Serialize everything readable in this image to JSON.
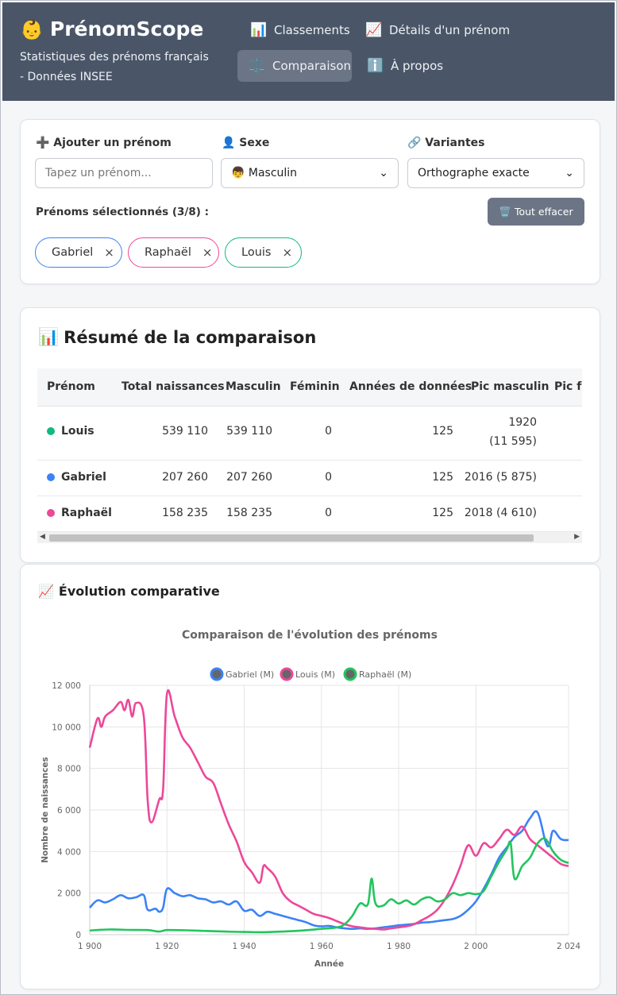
{
  "header": {
    "logo_icon": "baby-face-emoji",
    "logo_glyph": "👶",
    "title": "PrénomScope",
    "subtitle": "Statistiques des prénoms français - Données INSEE",
    "nav": [
      {
        "label": "Classements",
        "icon": "📊",
        "active": false
      },
      {
        "label": "Détails d'un prénom",
        "icon": "📈",
        "active": false
      },
      {
        "label": "Comparaison",
        "icon": "⚖️",
        "active": true
      },
      {
        "label": "À propos",
        "icon": "ℹ️",
        "active": false
      }
    ]
  },
  "controls": {
    "add_label": "➕ Ajouter un prénom",
    "add_placeholder": "Tapez un prénom...",
    "sex_label": "👤 Sexe",
    "sex_value": "👦 Masculin",
    "variants_label": "🔗 Variantes",
    "variants_value": "Orthographe exacte",
    "selected_label": "Prénoms sélectionnés (3/8) :",
    "clear_icon": "🗑️",
    "clear_label": "Tout effacer",
    "chips": [
      {
        "name": "Gabriel",
        "color": "#3b82f6"
      },
      {
        "name": "Raphaël",
        "color": "#ec4899"
      },
      {
        "name": "Louis",
        "color": "#10b981"
      }
    ]
  },
  "summary": {
    "icon": "📊",
    "title": "Résumé de la comparaison",
    "columns": [
      "Prénom",
      "Total naissances",
      "Masculin",
      "Féminin",
      "Années de données",
      "Pic masculin",
      "Pic fé"
    ],
    "rows": [
      {
        "name": "Louis",
        "color": "#10b981",
        "total": "539 110",
        "masc": "539 110",
        "fem": "0",
        "years": "125",
        "peak_year": "1920",
        "peak_val": "(11 595)"
      },
      {
        "name": "Gabriel",
        "color": "#3b82f6",
        "total": "207 260",
        "masc": "207 260",
        "fem": "0",
        "years": "125",
        "peak": "2016 (5 875)"
      },
      {
        "name": "Raphaël",
        "color": "#ec4899",
        "total": "158 235",
        "masc": "158 235",
        "fem": "0",
        "years": "125",
        "peak": "2018 (4 610)"
      }
    ]
  },
  "evolution": {
    "icon": "📈",
    "title": "Évolution comparative"
  },
  "chart_data": {
    "type": "line",
    "title": "Comparaison de l'évolution des prénoms",
    "xlabel": "Année",
    "ylabel": "Nombre de naissances",
    "xlim": [
      1900,
      2024
    ],
    "ylim": [
      0,
      12000
    ],
    "x_ticks": [
      "1 900",
      "1 920",
      "1 940",
      "1 960",
      "1 980",
      "2 000",
      "2 024"
    ],
    "x_tick_values": [
      1900,
      1920,
      1940,
      1960,
      1980,
      2000,
      2024
    ],
    "y_ticks": [
      "0",
      "2 000",
      "4 000",
      "6 000",
      "8 000",
      "10 000",
      "12 000"
    ],
    "y_tick_values": [
      0,
      2000,
      4000,
      6000,
      8000,
      10000,
      12000
    ],
    "grid": true,
    "legend_position": "top",
    "series": [
      {
        "name": "Gabriel (M)",
        "color": "#3b82f6",
        "points": [
          [
            1900,
            1300
          ],
          [
            1902,
            1650
          ],
          [
            1904,
            1550
          ],
          [
            1906,
            1700
          ],
          [
            1908,
            1900
          ],
          [
            1910,
            1750
          ],
          [
            1912,
            1800
          ],
          [
            1914,
            1900
          ],
          [
            1915,
            1200
          ],
          [
            1917,
            1250
          ],
          [
            1918,
            1100
          ],
          [
            1919,
            1300
          ],
          [
            1920,
            2200
          ],
          [
            1922,
            2000
          ],
          [
            1924,
            1850
          ],
          [
            1926,
            1900
          ],
          [
            1928,
            1750
          ],
          [
            1930,
            1700
          ],
          [
            1932,
            1550
          ],
          [
            1934,
            1600
          ],
          [
            1936,
            1450
          ],
          [
            1938,
            1600
          ],
          [
            1940,
            1150
          ],
          [
            1942,
            1200
          ],
          [
            1944,
            900
          ],
          [
            1946,
            1100
          ],
          [
            1948,
            1000
          ],
          [
            1950,
            900
          ],
          [
            1952,
            800
          ],
          [
            1954,
            700
          ],
          [
            1956,
            600
          ],
          [
            1958,
            450
          ],
          [
            1960,
            400
          ],
          [
            1962,
            420
          ],
          [
            1964,
            350
          ],
          [
            1966,
            300
          ],
          [
            1968,
            280
          ],
          [
            1970,
            300
          ],
          [
            1972,
            280
          ],
          [
            1974,
            300
          ],
          [
            1976,
            350
          ],
          [
            1978,
            400
          ],
          [
            1980,
            450
          ],
          [
            1982,
            480
          ],
          [
            1984,
            520
          ],
          [
            1986,
            580
          ],
          [
            1988,
            600
          ],
          [
            1990,
            650
          ],
          [
            1992,
            700
          ],
          [
            1994,
            750
          ],
          [
            1996,
            900
          ],
          [
            1998,
            1200
          ],
          [
            2000,
            1600
          ],
          [
            2002,
            2200
          ],
          [
            2004,
            2900
          ],
          [
            2006,
            3700
          ],
          [
            2008,
            4200
          ],
          [
            2010,
            4700
          ],
          [
            2012,
            5000
          ],
          [
            2014,
            5600
          ],
          [
            2016,
            5875
          ],
          [
            2018,
            4500
          ],
          [
            2019,
            4300
          ],
          [
            2020,
            5000
          ],
          [
            2022,
            4600
          ],
          [
            2024,
            4550
          ]
        ]
      },
      {
        "name": "Louis (M)",
        "color": "#ec4899",
        "points": [
          [
            1900,
            9000
          ],
          [
            1902,
            10400
          ],
          [
            1903,
            10000
          ],
          [
            1904,
            10500
          ],
          [
            1906,
            10800
          ],
          [
            1908,
            11200
          ],
          [
            1909,
            10800
          ],
          [
            1910,
            11300
          ],
          [
            1911,
            10500
          ],
          [
            1912,
            11150
          ],
          [
            1914,
            10500
          ],
          [
            1915,
            6500
          ],
          [
            1916,
            5400
          ],
          [
            1918,
            6500
          ],
          [
            1919,
            7000
          ],
          [
            1920,
            11595
          ],
          [
            1922,
            10500
          ],
          [
            1924,
            9500
          ],
          [
            1926,
            9000
          ],
          [
            1928,
            8300
          ],
          [
            1930,
            7600
          ],
          [
            1932,
            7300
          ],
          [
            1934,
            6300
          ],
          [
            1936,
            5300
          ],
          [
            1938,
            4500
          ],
          [
            1940,
            3500
          ],
          [
            1942,
            3000
          ],
          [
            1944,
            2500
          ],
          [
            1945,
            3300
          ],
          [
            1946,
            3200
          ],
          [
            1948,
            2800
          ],
          [
            1950,
            2000
          ],
          [
            1952,
            1600
          ],
          [
            1954,
            1400
          ],
          [
            1956,
            1200
          ],
          [
            1958,
            1000
          ],
          [
            1960,
            900
          ],
          [
            1962,
            800
          ],
          [
            1964,
            650
          ],
          [
            1966,
            500
          ],
          [
            1968,
            400
          ],
          [
            1970,
            350
          ],
          [
            1972,
            300
          ],
          [
            1974,
            280
          ],
          [
            1976,
            250
          ],
          [
            1978,
            300
          ],
          [
            1980,
            350
          ],
          [
            1982,
            400
          ],
          [
            1984,
            500
          ],
          [
            1986,
            700
          ],
          [
            1988,
            900
          ],
          [
            1990,
            1200
          ],
          [
            1992,
            1700
          ],
          [
            1994,
            2400
          ],
          [
            1996,
            3300
          ],
          [
            1998,
            4300
          ],
          [
            2000,
            3800
          ],
          [
            2002,
            4400
          ],
          [
            2004,
            4200
          ],
          [
            2006,
            4600
          ],
          [
            2008,
            5050
          ],
          [
            2010,
            4800
          ],
          [
            2012,
            5200
          ],
          [
            2014,
            4600
          ],
          [
            2016,
            4300
          ],
          [
            2018,
            4000
          ],
          [
            2020,
            3700
          ],
          [
            2022,
            3400
          ],
          [
            2024,
            3300
          ]
        ]
      },
      {
        "name": "Raphaël (M)",
        "color": "#22c55e",
        "points": [
          [
            1900,
            200
          ],
          [
            1905,
            250
          ],
          [
            1910,
            230
          ],
          [
            1915,
            220
          ],
          [
            1918,
            150
          ],
          [
            1920,
            220
          ],
          [
            1925,
            210
          ],
          [
            1930,
            180
          ],
          [
            1935,
            150
          ],
          [
            1940,
            130
          ],
          [
            1945,
            120
          ],
          [
            1950,
            150
          ],
          [
            1955,
            200
          ],
          [
            1960,
            280
          ],
          [
            1964,
            350
          ],
          [
            1966,
            500
          ],
          [
            1968,
            900
          ],
          [
            1970,
            1500
          ],
          [
            1972,
            1450
          ],
          [
            1973,
            2700
          ],
          [
            1974,
            1500
          ],
          [
            1976,
            1400
          ],
          [
            1978,
            1700
          ],
          [
            1980,
            1500
          ],
          [
            1982,
            1650
          ],
          [
            1984,
            1450
          ],
          [
            1986,
            1700
          ],
          [
            1988,
            1800
          ],
          [
            1990,
            1600
          ],
          [
            1992,
            1700
          ],
          [
            1994,
            2000
          ],
          [
            1996,
            1900
          ],
          [
            1998,
            2000
          ],
          [
            2000,
            1950
          ],
          [
            2002,
            2100
          ],
          [
            2004,
            2800
          ],
          [
            2006,
            3500
          ],
          [
            2008,
            4100
          ],
          [
            2009,
            4400
          ],
          [
            2010,
            2700
          ],
          [
            2012,
            3300
          ],
          [
            2014,
            3700
          ],
          [
            2016,
            4400
          ],
          [
            2018,
            4610
          ],
          [
            2020,
            4000
          ],
          [
            2022,
            3600
          ],
          [
            2024,
            3450
          ]
        ]
      }
    ]
  }
}
